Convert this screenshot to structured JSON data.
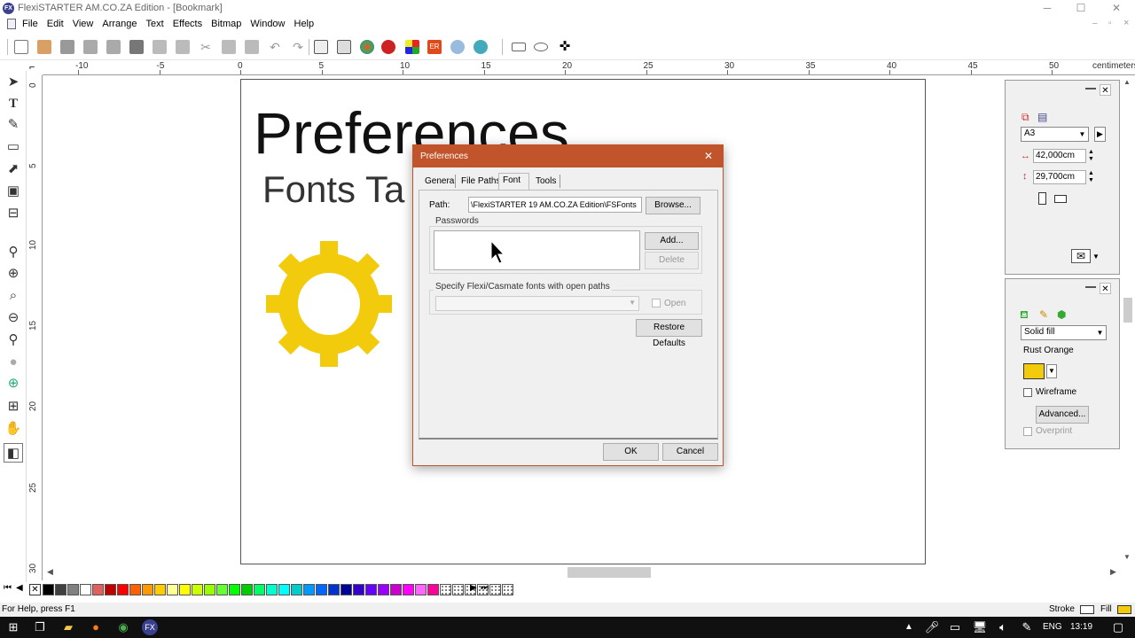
{
  "window": {
    "title": "FlexiSTARTER AM.CO.ZA Edition - [Bookmark]",
    "app_icon": "FX",
    "minimize": "─",
    "maximize": "☐",
    "close": "✕",
    "doc_minimize": "–",
    "doc_restore": "▫",
    "doc_close": "×"
  },
  "menu": [
    "File",
    "Edit",
    "View",
    "Arrange",
    "Text",
    "Effects",
    "Bitmap",
    "Window",
    "Help"
  ],
  "ruler": {
    "unit": "centimeters",
    "h_labels": [
      "-10",
      "-5",
      "0",
      "5",
      "10",
      "15",
      "20",
      "25",
      "30",
      "35",
      "40",
      "45",
      "50"
    ],
    "v_labels": [
      "0",
      "5",
      "10",
      "15",
      "20",
      "25",
      "30"
    ]
  },
  "canvas": {
    "title_text": "Preferences",
    "subtitle_text": "Fonts Ta",
    "gear_color": "#f2cc0c"
  },
  "dialog": {
    "title": "Preferences",
    "close": "✕",
    "tabs": [
      "General",
      "File Paths",
      "Font",
      "Tools"
    ],
    "active_tab": "Font",
    "path_label": "Path:",
    "path_value": "\\FlexiSTARTER 19 AM.CO.ZA Edition\\FSFonts",
    "browse_label": "Browse...",
    "passwords_label": "Passwords",
    "add_label": "Add...",
    "delete_label": "Delete",
    "open_paths_label": "Specify Flexi/Casmate fonts with open paths",
    "open_label": "Open",
    "restore_label": "Restore Defaults",
    "ok_label": "OK",
    "cancel_label": "Cancel"
  },
  "page_panel": {
    "size": "A3",
    "width": "42,000cm",
    "height": "29,700cm"
  },
  "fill_panel": {
    "fill_type": "Solid fill",
    "color_name": "Rust Orange",
    "color": "#f2cc0c",
    "wireframe_label": "Wireframe",
    "advanced_label": "Advanced...",
    "overprint_label": "Overprint"
  },
  "status": {
    "help": "For Help, press F1",
    "stroke_label": "Stroke",
    "fill_label": "Fill",
    "fill_color": "#f2cc0c"
  },
  "taskbar": {
    "lang": "ENG",
    "time": "13:19"
  },
  "palette_colors": [
    "#000000",
    "#404040",
    "#808080",
    "#ffffff",
    "#e06060",
    "#c00000",
    "#ff0000",
    "#ff6000",
    "#ff9900",
    "#ffcc00",
    "#ffff99",
    "#ffff00",
    "#ccff00",
    "#99ff00",
    "#66ff33",
    "#00ff00",
    "#00cc00",
    "#00ff66",
    "#00ffcc",
    "#00ffff",
    "#00cccc",
    "#0099ff",
    "#0066ff",
    "#0033cc",
    "#000099",
    "#3300cc",
    "#6600ff",
    "#9900ff",
    "#cc00cc",
    "#ff00ff",
    "#ff66ff",
    "#ff0099"
  ]
}
